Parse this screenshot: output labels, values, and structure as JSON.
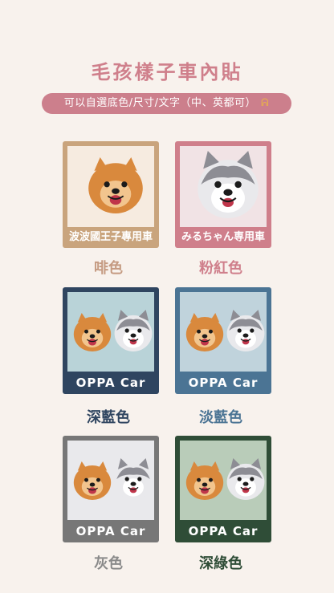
{
  "header": {
    "title": "毛孩樣子車內貼",
    "subtitle": "可以自選底色/尺寸/文字（中、英都可）",
    "subtitle_icon": "hands-icon"
  },
  "products": [
    {
      "caption": "波波國王子專用車",
      "color_name": "啡色",
      "frame": "#c9a47d",
      "bg": "#f6ebe0",
      "label_color": "#c59b82"
    },
    {
      "caption": "みるちゃん専用車",
      "color_name": "粉紅色",
      "frame": "#cf7f8b",
      "bg": "#f1e3e5",
      "label_color": "#cf7f8b"
    },
    {
      "caption": "OPPA Car",
      "color_name": "深藍色",
      "frame": "#2f4560",
      "bg": "#b9d3d8",
      "label_color": "#2f4560"
    },
    {
      "caption": "OPPA Car",
      "color_name": "淡藍色",
      "frame": "#4b7494",
      "bg": "#c0d3dc",
      "label_color": "#4b7494"
    },
    {
      "caption": "OPPA Car",
      "color_name": "灰色",
      "frame": "#777777",
      "bg": "#e9e9ec",
      "label_color": "#8a8a8a"
    },
    {
      "caption": "OPPA Car",
      "color_name": "深綠色",
      "frame": "#2f4d37",
      "bg": "#b9ccb9",
      "label_color": "#2f4d37"
    }
  ]
}
